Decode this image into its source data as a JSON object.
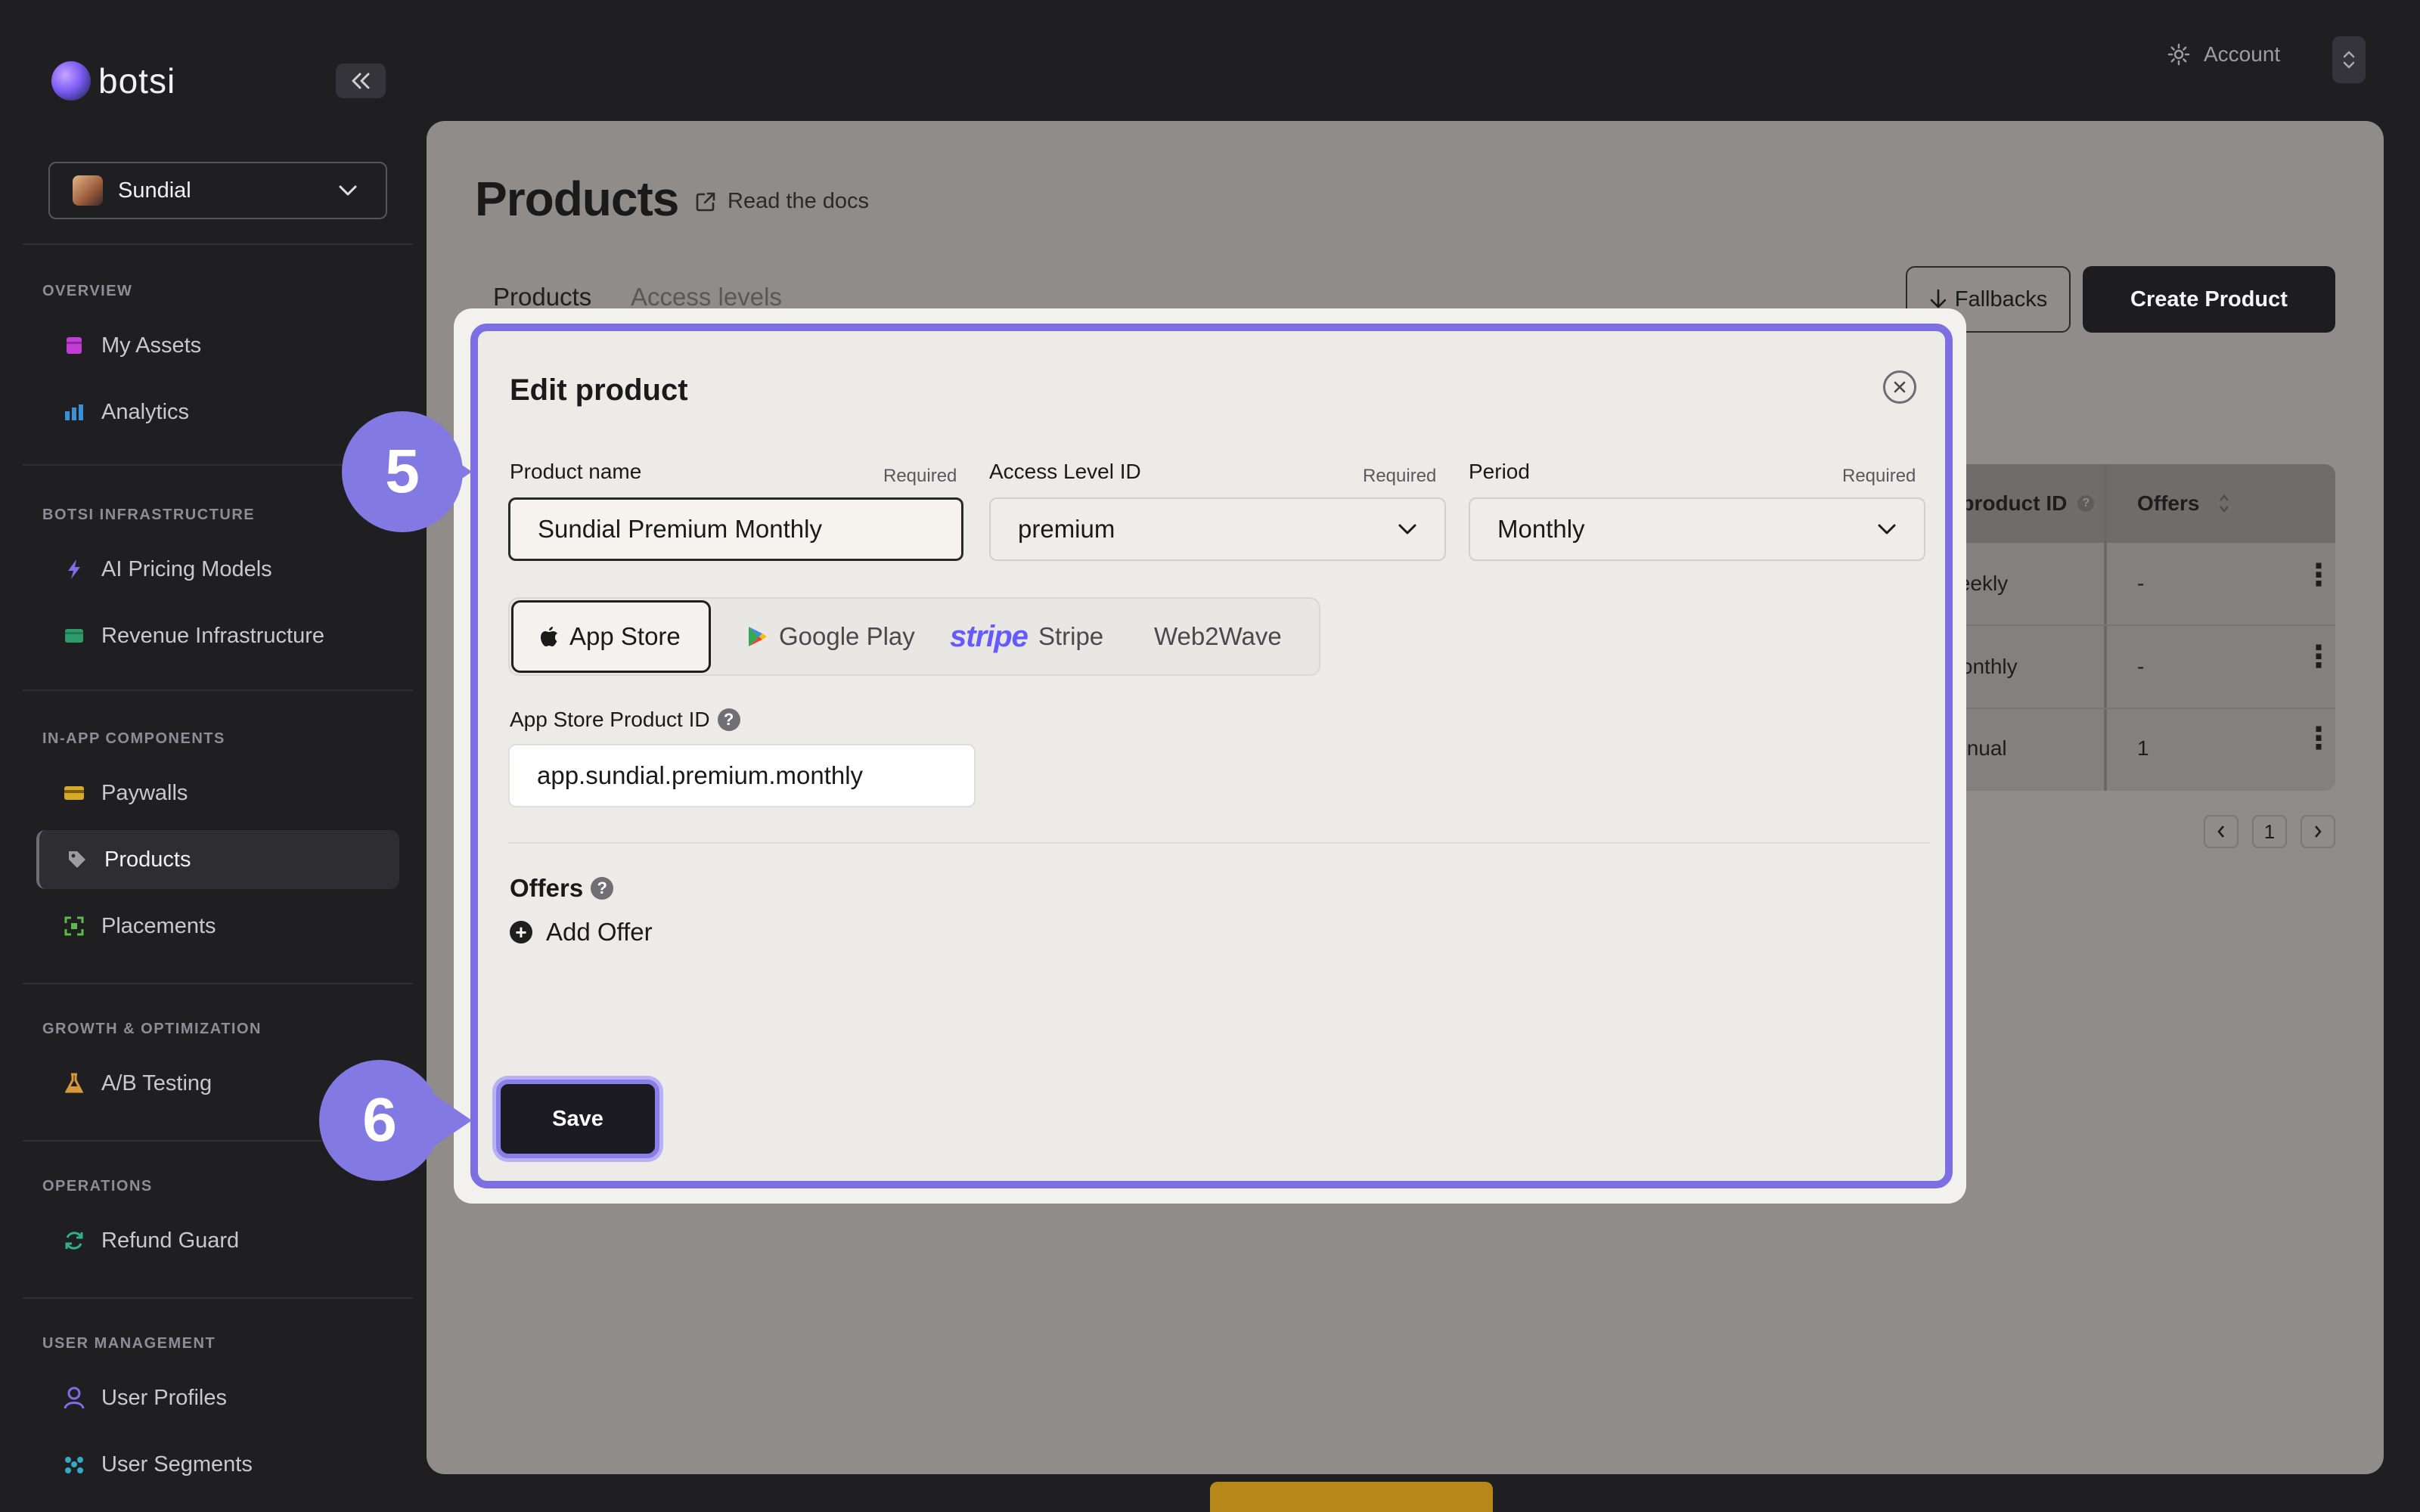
{
  "sidebar": {
    "logo_text": "botsi",
    "collapse_icon": "chevrons-left-icon",
    "app_name": "Sundial",
    "sections": {
      "overview": "OVERVIEW",
      "infra": "BOTSI INFRASTRUCTURE",
      "inapp": "IN-APP COMPONENTS",
      "growth": "GROWTH & OPTIMIZATION",
      "ops": "OPERATIONS",
      "users": "USER MANAGEMENT"
    },
    "items": {
      "my_assets": "My Assets",
      "analytics": "Analytics",
      "ai_pricing": "AI Pricing Models",
      "revenue_infra": "Revenue Infrastructure",
      "paywalls": "Paywalls",
      "products": "Products",
      "placements": "Placements",
      "ab_testing": "A/B Testing",
      "refund_guard": "Refund Guard",
      "user_profiles": "User Profiles",
      "user_segments": "User Segments"
    },
    "active_item": "Products"
  },
  "topbar": {
    "account_label": "Account"
  },
  "page": {
    "title": "Products",
    "docs_link": "Read the docs",
    "tabs": [
      "Products",
      "Access levels"
    ],
    "fallbacks_label": "Fallbacks",
    "create_label": "Create Product"
  },
  "table": {
    "headers": [
      "e product ID",
      "Offers"
    ],
    "rows": [
      [
        "_weekly",
        "-"
      ],
      [
        "_monthly",
        "-"
      ],
      [
        "_annual",
        "1"
      ]
    ],
    "page": "1"
  },
  "modal": {
    "title": "Edit product",
    "required_label": "Required",
    "product_name_label": "Product name",
    "product_name_value": "Sundial Premium Monthly",
    "access_level_label": "Access Level ID",
    "access_level_value": "premium",
    "period_label": "Period",
    "period_value": "Monthly",
    "stores": [
      "App Store",
      "Google Play",
      "Stripe",
      "Web2Wave"
    ],
    "stripe_wordmark": "stripe",
    "active_store": "App Store",
    "store_product_label": "App Store Product ID",
    "store_product_value": "app.sundial.premium.monthly",
    "offers_title": "Offers",
    "add_offer_label": "Add Offer",
    "save_label": "Save"
  },
  "callouts": [
    "5",
    "6"
  ],
  "colors": {
    "accent": "#7b6fe2",
    "callout": "#8379e2",
    "stripe": "#635bff",
    "sidebar_bg": "#1f1f22"
  }
}
